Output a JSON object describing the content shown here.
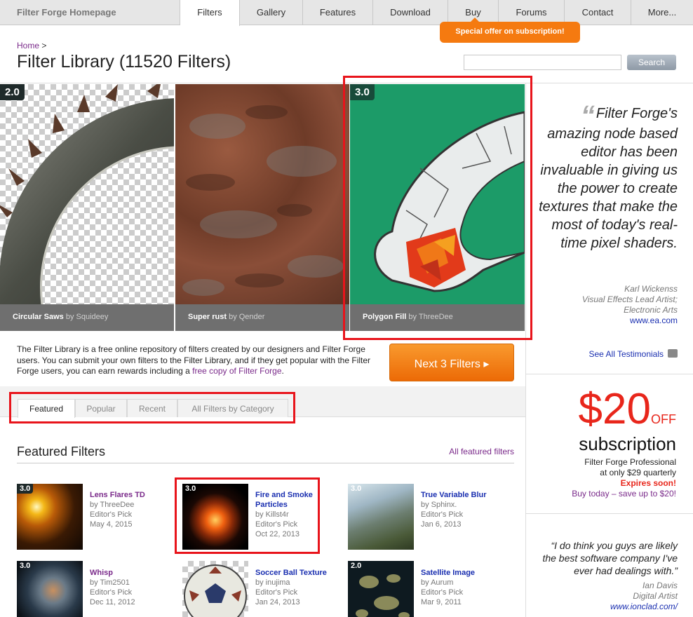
{
  "nav": {
    "brand": "Filter Forge Homepage",
    "tabs": [
      "Filters",
      "Gallery",
      "Features",
      "Download",
      "Buy",
      "Forums",
      "Contact",
      "More..."
    ],
    "promo": "Special offer on subscription!"
  },
  "header": {
    "breadcrumb_home": "Home",
    "breadcrumb_sep": ">",
    "title": "Filter Library (11520 Filters)",
    "search_placeholder": "",
    "search_button": "Search"
  },
  "slides": [
    {
      "name": "Circular Saws",
      "by": "by Squideey",
      "version": "2.0"
    },
    {
      "name": "Super rust",
      "by": "by Qender",
      "version": ""
    },
    {
      "name": "Polygon Fill",
      "by": "by ThreeDee",
      "version": "3.0"
    }
  ],
  "testimonial1": {
    "quote": "Filter Forge's amazing node based editor has been invaluable in giving us the power to create textures that make the most of today's real-time pixel shaders.",
    "author": "Karl Wickenss",
    "role": "Visual Effects Lead Artist;",
    "company": "Electronic Arts",
    "link": "www.ea.com"
  },
  "see_all": "See All Testimonials",
  "subscription": {
    "price": "$20",
    "off": "OFF",
    "title": "subscription",
    "line1": "Filter Forge Professional",
    "line2": "at only $29 quarterly",
    "line3": "Expires soon!",
    "line4": "Buy today – save up to $20!"
  },
  "testimonial2": {
    "quote": "“I do think you guys are likely the best software company I've ever had dealings with.”",
    "author": "Ian Davis",
    "role": "Digital Artist",
    "link": "www.ionclad.com/"
  },
  "description": {
    "text": "The Filter Library is a free online repository of filters created by our designers and Filter Forge users. You can submit your own filters to the Filter Library, and if they get popular with the Filter Forge users, you can earn rewards including a ",
    "link": "free copy of Filter Forge",
    "end": "."
  },
  "next_button": "Next 3 Filters ▸",
  "filter_tabs": [
    "Featured",
    "Popular",
    "Recent",
    "All Filters by Category"
  ],
  "featured": {
    "title": "Featured Filters",
    "all_link": "All featured filters",
    "items": [
      {
        "name": "Lens Flares TD",
        "by": "by ThreeDee",
        "pick": "Editor's Pick",
        "date": "May 4, 2015",
        "version": "3.0",
        "color": "#7a2a8a"
      },
      {
        "name": "Fire and Smoke Particles",
        "by": "by Killst4r",
        "pick": "Editor's Pick",
        "date": "Oct 22, 2013",
        "version": "3.0",
        "color": "#1a2fb0"
      },
      {
        "name": "True Variable Blur",
        "by": "by Sphinx.",
        "pick": "Editor's Pick",
        "date": "Jan 6, 2013",
        "version": "3.0",
        "color": "#1a2fb0"
      },
      {
        "name": "Whisp",
        "by": "by Tim2501",
        "pick": "Editor's Pick",
        "date": "Dec 11, 2012",
        "version": "3.0",
        "color": "#7a2a8a"
      },
      {
        "name": "Soccer Ball Texture",
        "by": "by inujima",
        "pick": "Editor's Pick",
        "date": "Jan 24, 2013",
        "version": "",
        "color": "#1a2fb0"
      },
      {
        "name": "Satellite Image",
        "by": "by Aurum",
        "pick": "Editor's Pick",
        "date": "Mar 9, 2011",
        "version": "2.0",
        "color": "#1a2fb0"
      }
    ]
  },
  "colors": {
    "accent": "#f57a10",
    "highlight": "#e8141b",
    "link": "#1a2fb0",
    "visited": "#7a2a8a",
    "price": "#e8261b"
  }
}
